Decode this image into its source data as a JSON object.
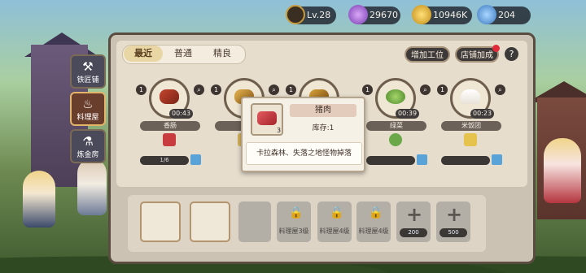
{
  "colors": {
    "accent": "#e8d7a5",
    "panel": "#cbc2b4",
    "dark": "#3f3a3a",
    "notice": "#e02a3a"
  },
  "resources": {
    "level": "Lv.28",
    "gems": "29670",
    "coins": "10946K",
    "tickets": "204"
  },
  "sidebar": {
    "items": [
      {
        "label": "铁匠铺",
        "icon": "anvil-icon"
      },
      {
        "label": "料理屋",
        "icon": "cooking-pot-icon"
      },
      {
        "label": "炼金房",
        "icon": "flask-icon"
      }
    ]
  },
  "tabs": [
    "最近",
    "普通",
    "精良"
  ],
  "top_buttons": {
    "add_worker": "增加工位",
    "shop_bonus": "店铺加成",
    "help": "?"
  },
  "recipes": [
    {
      "num": "1",
      "name": "香肠",
      "timer": "00:43",
      "progress": "1/6",
      "icon": "sausage-icon"
    },
    {
      "num": "1",
      "name": "咖",
      "timer": "",
      "progress": "",
      "icon": "curry-icon"
    },
    {
      "num": "1",
      "name": "",
      "timer": "",
      "progress": "",
      "icon": "roast-icon"
    },
    {
      "num": "1",
      "name": "绿菜",
      "timer": "00:39",
      "progress": "",
      "icon": "green-soup-icon"
    },
    {
      "num": "1",
      "name": "米饭团",
      "timer": "00:23",
      "progress": "",
      "icon": "rice-ball-icon"
    }
  ],
  "slots": [
    {
      "type": "open"
    },
    {
      "type": "open"
    },
    {
      "type": "empty"
    },
    {
      "type": "lock",
      "label": "料理屋3级"
    },
    {
      "type": "lock",
      "label": "料理屋4级"
    },
    {
      "type": "lock",
      "label": "料理屋4级"
    },
    {
      "type": "add",
      "cost": "200"
    },
    {
      "type": "add",
      "cost": "500"
    }
  ],
  "tooltip": {
    "name": "猪肉",
    "qty": "3",
    "stock": "库存:1",
    "source": "卡拉森林、失落之地怪物掉落"
  }
}
